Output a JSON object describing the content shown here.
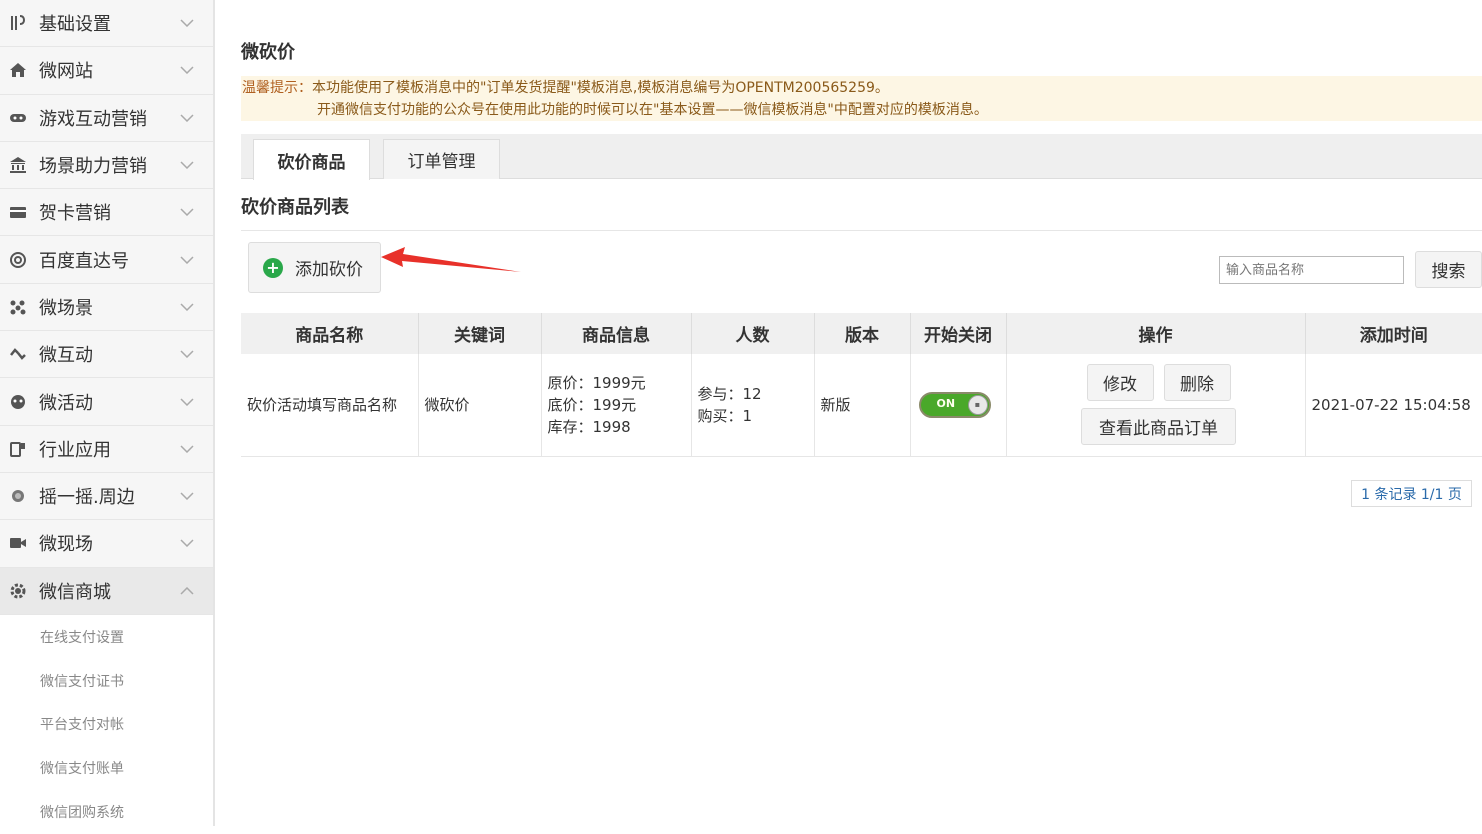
{
  "sidebar": {
    "items": [
      {
        "label": "基础设置",
        "icon": "tools-icon"
      },
      {
        "label": "微网站",
        "icon": "home-icon"
      },
      {
        "label": "游戏互动营销",
        "icon": "gamepad-icon"
      },
      {
        "label": "场景助力营销",
        "icon": "bank-icon"
      },
      {
        "label": "贺卡营销",
        "icon": "card-icon"
      },
      {
        "label": "百度直达号",
        "icon": "at-icon"
      },
      {
        "label": "微场景",
        "icon": "dots-icon"
      },
      {
        "label": "微互动",
        "icon": "link-icon"
      },
      {
        "label": "微活动",
        "icon": "face-icon"
      },
      {
        "label": "行业应用",
        "icon": "apps-icon"
      },
      {
        "label": "摇一摇.周边",
        "icon": "shake-icon"
      },
      {
        "label": "微现场",
        "icon": "video-icon"
      },
      {
        "label": "微信商城",
        "icon": "gear-icon"
      }
    ],
    "subitems": [
      "在线支付设置",
      "微信支付证书",
      "平台支付对帐",
      "微信支付账单",
      "微信团购系统"
    ]
  },
  "page": {
    "title": "微砍价",
    "tip_prefix": "温馨提示：",
    "tip_line1": "本功能使用了模板消息中的\"订单发货提醒\"模板消息,模板消息编号为OPENTM200565259。",
    "tip_line2": "开通微信支付功能的公众号在使用此功能的时候可以在\"基本设置——微信模板消息\"中配置对应的模板消息。"
  },
  "tabs": [
    {
      "label": "砍价商品"
    },
    {
      "label": "订单管理"
    }
  ],
  "section": {
    "title": "砍价商品列表"
  },
  "toolbar": {
    "add_label": "添加砍价",
    "search_placeholder": "输入商品名称",
    "search_label": "搜索"
  },
  "table": {
    "headers": [
      "商品名称",
      "关键词",
      "商品信息",
      "人数",
      "版本",
      "开始关闭",
      "操作",
      "添加时间"
    ],
    "rows": [
      {
        "name": "砍价活动填写商品名称",
        "keyword": "微砍价",
        "info": [
          "原价：1999元",
          "底价：199元",
          "库存：1998"
        ],
        "people": [
          "参与：12",
          "购买：1"
        ],
        "version": "新版",
        "toggle_label": "ON",
        "edit_label": "修改",
        "delete_label": "删除",
        "orders_label": "查看此商品订单",
        "added_at": "2021-07-22 15:04:58"
      }
    ]
  },
  "pager": {
    "text": "1 条记录 1/1 页"
  },
  "colors": {
    "accent_green": "#2aa84a",
    "tip_bg": "#fdf6e4",
    "arrow_red": "#e8312a"
  }
}
